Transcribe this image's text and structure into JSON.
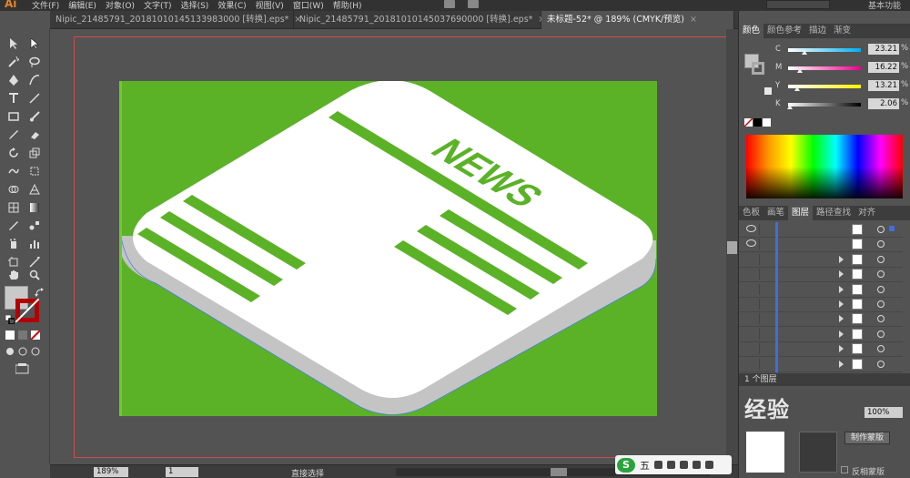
{
  "app": {
    "logo": "Ai"
  },
  "menu": {
    "items": [
      "文件(F)",
      "编辑(E)",
      "对象(O)",
      "文字(T)",
      "选择(S)",
      "效果(C)",
      "视图(V)",
      "窗口(W)",
      "帮助(H)"
    ],
    "workspace": "基本功能"
  },
  "tabs": [
    {
      "label": "Nipic_21485791_20181010145133983000 [转换].eps*",
      "close": "×"
    },
    {
      "label": "Nipic_21485791_20181010145037690000 [转换].eps*",
      "close": "×"
    },
    {
      "label": "未标题-52* @ 189% (CMYK/预览)",
      "close": "×"
    }
  ],
  "artwork": {
    "headline": "NEWS",
    "background_color": "#5bb227",
    "paper_color": "#ffffff",
    "shadow_color": "#c4c4c4",
    "stripe_color": "#5bb227"
  },
  "statusbar": {
    "zoom": "189%",
    "page": "1",
    "tool": "直接选择"
  },
  "color_panel": {
    "tabs": [
      "颜色",
      "颜色参考",
      "描边",
      "渐变"
    ],
    "channels": [
      {
        "label": "C",
        "value": "23.21",
        "unit": "%",
        "level": 0.23
      },
      {
        "label": "M",
        "value": "16.22",
        "unit": "%",
        "level": 0.16
      },
      {
        "label": "Y",
        "value": "13.21",
        "unit": "%",
        "level": 0.13
      },
      {
        "label": "K",
        "value": "2.06",
        "unit": "%",
        "level": 0.02
      }
    ]
  },
  "layers_panel": {
    "tabs": [
      "色板",
      "画笔",
      "图层",
      "路径查找",
      "对齐"
    ],
    "footer": "1 个图层",
    "row_count": 10
  },
  "transparency_panel": {
    "opacity": "100%",
    "make_mask": "制作蒙版",
    "invert_mask": "反相蒙版"
  },
  "ime": {
    "logo": "S",
    "mode": "五"
  },
  "watermark": "经验"
}
